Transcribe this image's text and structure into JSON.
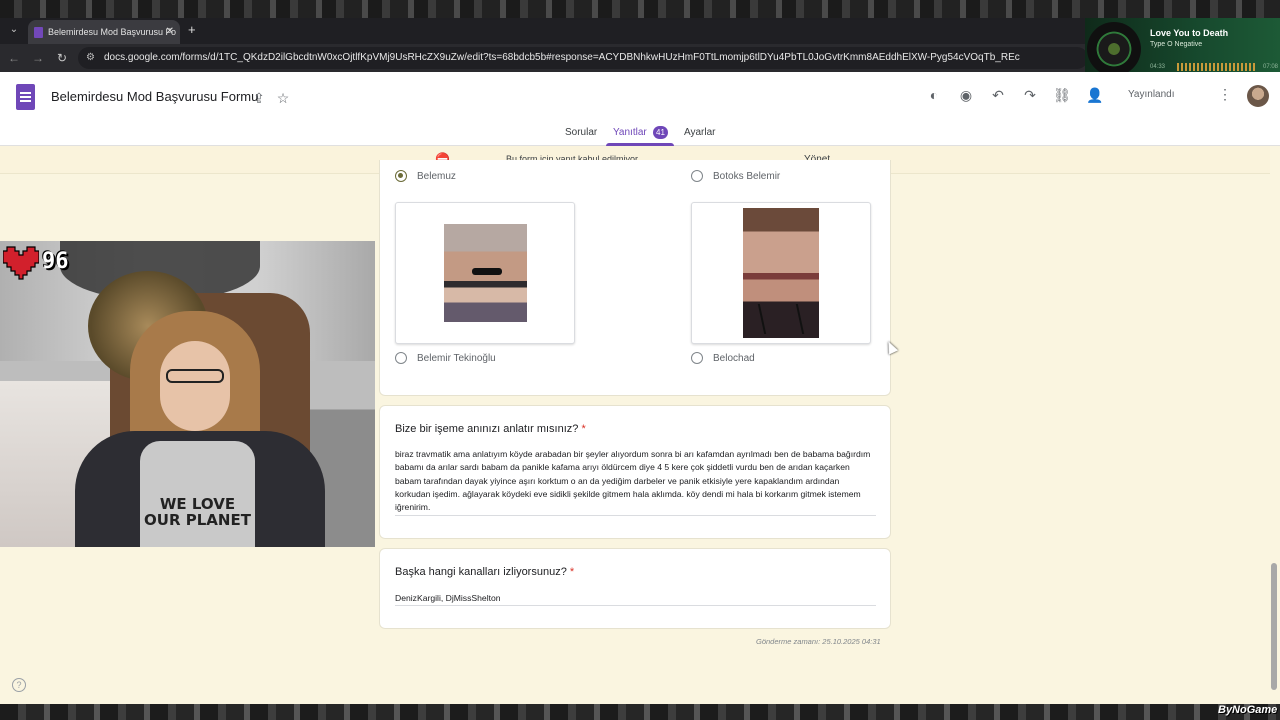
{
  "browser": {
    "tab_title": "Belemirdesu Mod Başvurusu Fo",
    "url": "docs.google.com/forms/d/1TC_QKdzD2ilGbcdtnW0xcOjtlfKpVMj9UsRHcZX9uZw/edit?ts=68bdcb5b#response=ACYDBNhkwHUzHmF0TtLmomjp6tlDYu4PbTL0JoGvtrKmm8AEddhElXW-Pyg54cVOqTb_REc"
  },
  "spotify": {
    "song_title": "Love You to Death",
    "artist": "Type O Negative",
    "time_elapsed": "04:33",
    "time_total": "07:08",
    "progress_fraction": 0.64
  },
  "forms": {
    "title": "Belemirdesu Mod Başvurusu Formu",
    "publish_label": "Yayınlandı",
    "tabs": {
      "questions": "Sorular",
      "responses": "Yanıtlar",
      "responses_count": "41",
      "settings": "Ayarlar"
    },
    "banner": {
      "text": "Bu form için yanıt kabul edilmiyor.",
      "action": "Yönet"
    },
    "choices": {
      "top_left": "Belemuz",
      "top_right": "Botoks Belemir",
      "bottom_left": "Belemir Tekinoğlu",
      "bottom_right": "Belochad"
    },
    "q1": {
      "title": "Bize bir işeme anınızı anlatır mısınız?",
      "required": "*",
      "answer": "biraz travmatik ama anlatıyım köyde arabadan bir şeyler alıyordum sonra bi arı kafamdan ayrılmadı ben de babama bağırdım babamı da arılar sardı babam da panikle kafama arıyı öldürcem diye 4 5 kere çok şiddetli vurdu ben de arıdan kaçarken babam tarafından dayak yiyince aşırı korktum o an da  yediğim darbeler ve panik etkisiyle yere kapaklandım ardından korkudan işedim. ağlayarak köydeki eve sidikli şekilde gitmem hala aklımda. köy dendi mi hala bi korkarım gitmek istemem iğrenirim."
    },
    "q2": {
      "title": "Başka hangi kanalları izliyorsunuz?",
      "required": "*",
      "answer": "DenizKargili, DjMissShelton"
    },
    "submitted": "Gönderme zamanı: 25.10.2025 04:31"
  },
  "overlay": {
    "heart_count": "96",
    "shirt_text": "WE LOVE OUR PLANET",
    "watermark": "ByNoGame"
  },
  "colors": {
    "forms_purple": "#6f47b8",
    "banner_bg": "#faf3dc",
    "page_bg": "#faf5e0"
  }
}
